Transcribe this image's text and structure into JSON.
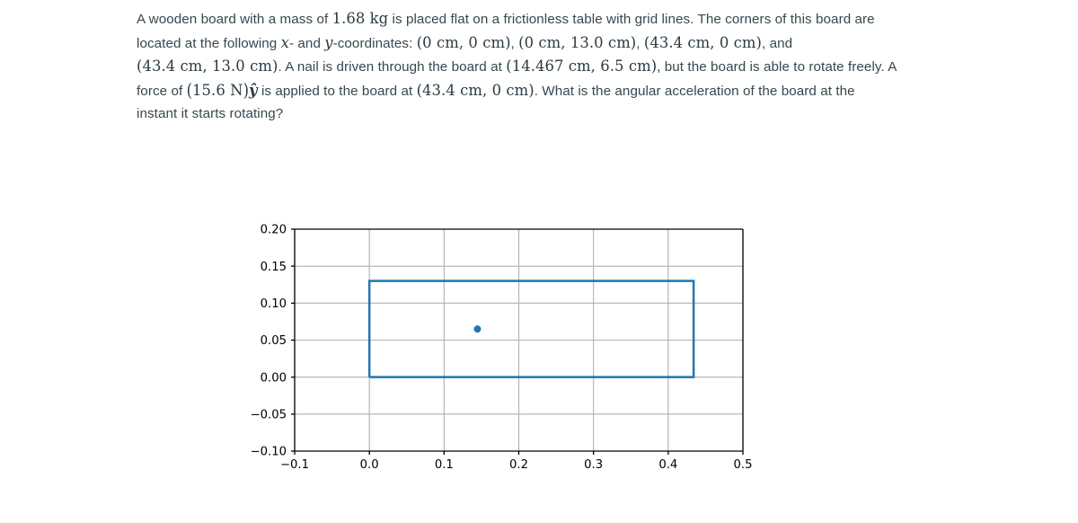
{
  "problem": {
    "line1_a": "A wooden board with a mass of ",
    "mass": "1.68 kg",
    "line1_b": " is placed flat on a frictionless table with grid lines. The corners of this board are located at the following ",
    "var_x": "x",
    "line2_a": "- and ",
    "var_y": "y",
    "line2_b": "-coordinates: ",
    "corner1": "(0 cm, 0 cm)",
    "sep1": ", ",
    "corner2": "(0 cm, 13.0 cm)",
    "sep2": ", ",
    "corner3": "(43.4 cm, 0 cm)",
    "sep3": ", and ",
    "corner4": "(43.4 cm, 13.0 cm)",
    "line3_a": ". A nail is driven through the board at ",
    "nail_point": "(14.467 cm, 6.5 cm)",
    "line3_b": ", but the board is able to rotate freely. A force of ",
    "force_open": "(",
    "force_mag": "15.6 N",
    "force_close": ")",
    "force_dir": "ŷ",
    "line4_a": " is applied to the board at ",
    "force_point": "(43.4 cm, 0 cm)",
    "line4_b": ". What is the angular acceleration of the board at the instant it starts rotating?"
  },
  "chart_data": {
    "type": "scatter",
    "title": "",
    "xlabel": "",
    "ylabel": "",
    "xlim": [
      -0.1,
      0.5
    ],
    "ylim": [
      -0.1,
      0.2
    ],
    "grid": true,
    "legend": "none",
    "x_ticks": [
      "-0.1",
      "0.0",
      "0.1",
      "0.2",
      "0.3",
      "0.4",
      "0.5"
    ],
    "x_tick_values": [
      -0.1,
      0.0,
      0.1,
      0.2,
      0.3,
      0.4,
      0.5
    ],
    "y_ticks": [
      "0.20",
      "0.15",
      "0.10",
      "0.05",
      "0.00",
      "-0.05",
      "-0.10"
    ],
    "y_tick_values": [
      0.2,
      0.15,
      0.1,
      0.05,
      0.0,
      -0.05,
      -0.1
    ],
    "series": [
      {
        "name": "board-outline",
        "type": "rectangle",
        "color": "#1f77b4",
        "linewidth": 2.5,
        "fill": "none",
        "corners": [
          [
            0.0,
            0.0
          ],
          [
            0.434,
            0.0
          ],
          [
            0.434,
            0.13
          ],
          [
            0.0,
            0.13
          ]
        ],
        "x": [
          0.0,
          0.434,
          0.434,
          0.0,
          0.0
        ],
        "y": [
          0.0,
          0.0,
          0.13,
          0.13,
          0.0
        ]
      },
      {
        "name": "nail-pivot-point",
        "type": "scatter",
        "color": "#1f77b4",
        "marker": "o",
        "markersize": 7,
        "x": [
          0.14467
        ],
        "y": [
          0.065
        ]
      }
    ]
  },
  "colors": {
    "accent": "#1f77b4",
    "grid": "#b0b0b0",
    "axis": "#000000",
    "text": "#37474f"
  }
}
